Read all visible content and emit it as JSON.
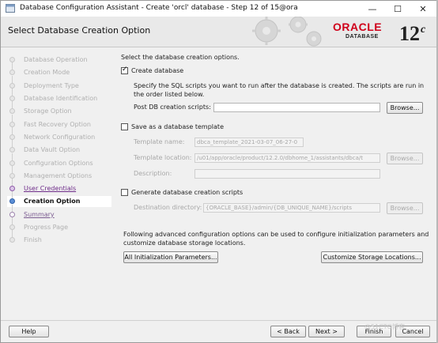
{
  "window": {
    "title": "Database Configuration Assistant - Create 'orcl' database - Step 12 of 15@ora",
    "controls": {
      "minimize": "—",
      "maximize": "☐",
      "close": "✕"
    }
  },
  "header": {
    "heading": "Select Database Creation Option",
    "brand": {
      "oracle": "ORACLE",
      "database": "DATABASE",
      "version": "12",
      "version_suffix": "c"
    }
  },
  "steps": [
    {
      "label": "Database Operation",
      "state": "disabled"
    },
    {
      "label": "Creation Mode",
      "state": "disabled"
    },
    {
      "label": "Deployment Type",
      "state": "disabled"
    },
    {
      "label": "Database Identification",
      "state": "disabled"
    },
    {
      "label": "Storage Option",
      "state": "disabled"
    },
    {
      "label": "Fast Recovery Option",
      "state": "disabled"
    },
    {
      "label": "Network Configuration",
      "state": "disabled"
    },
    {
      "label": "Data Vault Option",
      "state": "disabled"
    },
    {
      "label": "Configuration Options",
      "state": "disabled"
    },
    {
      "label": "Management Options",
      "state": "disabled"
    },
    {
      "label": "User Credentials",
      "state": "done"
    },
    {
      "label": "Creation Option",
      "state": "current"
    },
    {
      "label": "Summary",
      "state": "next"
    },
    {
      "label": "Progress Page",
      "state": "disabled"
    },
    {
      "label": "Finish",
      "state": "disabled"
    }
  ],
  "main": {
    "intro": "Select the database creation options.",
    "create_db": {
      "label": "Create database",
      "checked": true,
      "desc1": "Specify the SQL scripts you want to run after the database is created. The scripts are run in",
      "desc2": "the order listed below.",
      "post_label": "Post DB creation scripts:",
      "post_value": "",
      "browse": "Browse..."
    },
    "template": {
      "label": "Save as a database template",
      "checked": false,
      "name_label": "Template name:",
      "name_value": "dbca_template_2021-03-07_06-27-0",
      "location_label": "Template location:",
      "location_value": "/u01/app/oracle/product/12.2.0/dbhome_1/assistants/dbca/t",
      "browse": "Browse...",
      "description_label": "Description:",
      "description_value": ""
    },
    "scripts": {
      "label": "Generate database creation scripts",
      "checked": false,
      "dest_label": "Destination directory:",
      "dest_value": "{ORACLE_BASE}/admin/{DB_UNIQUE_NAME}/scripts",
      "browse": "Browse..."
    },
    "advanced1": "Following advanced configuration options can be used to configure initialization parameters and",
    "advanced2": "customize database storage locations.",
    "init_params_btn": "All Initialization Parameters...",
    "storage_btn": "Customize Storage Locations..."
  },
  "footer": {
    "help": "Help",
    "back": "< Back",
    "next": "Next >",
    "finish": "Finish",
    "cancel": "Cancel",
    "watermark": "@51CTO博客"
  }
}
